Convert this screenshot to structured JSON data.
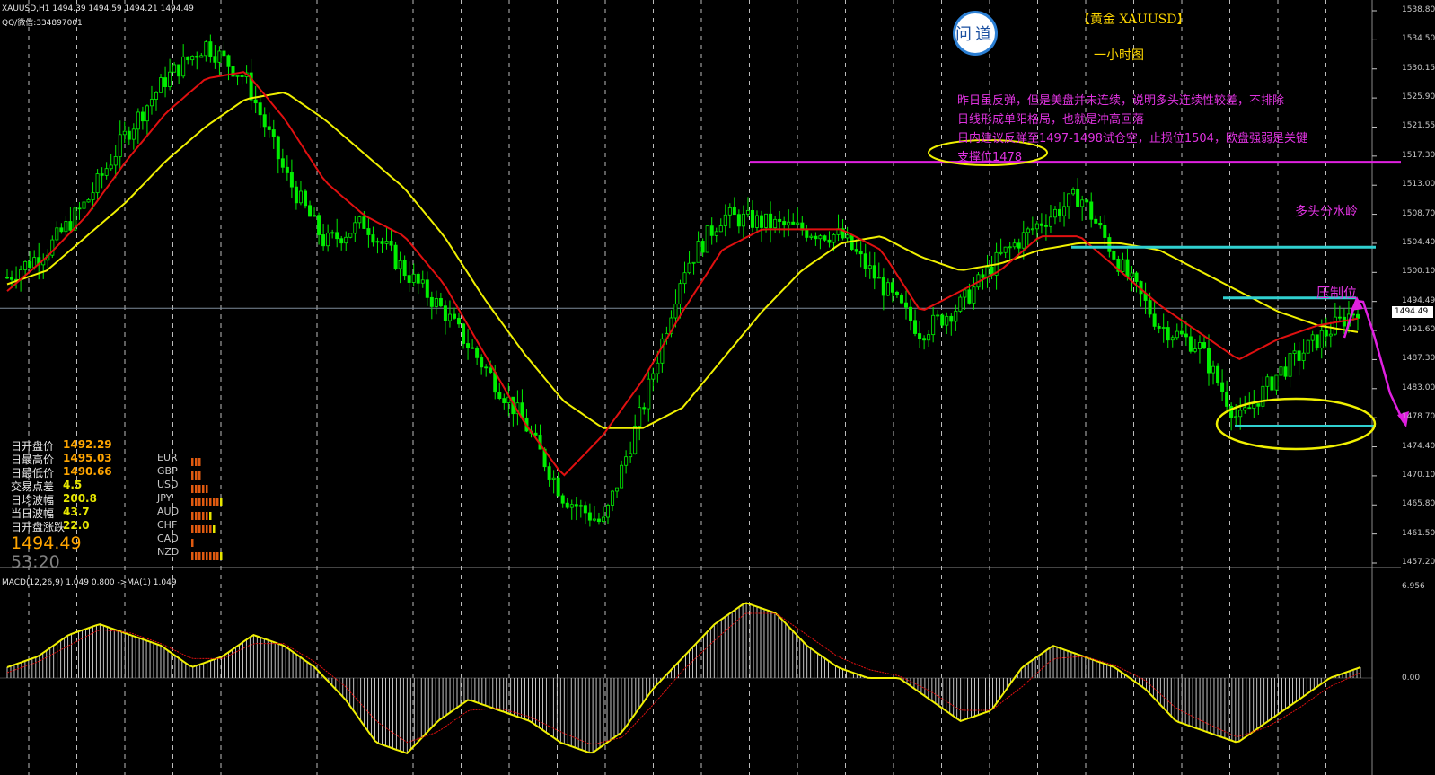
{
  "header": {
    "symbol_line": "XAUUSD,H1  1494.39 1494.59 1494.21 1494.49",
    "qq_line": "QQ/微信:334897001"
  },
  "logo": {
    "text": "问道"
  },
  "annotations": {
    "title": "【黄金 XAUUSD】",
    "subtitle": "一小时图",
    "note_lines": [
      "昨日虽反弹，但是美盘并未连续，说明多头连续性较差，不排除",
      "日线形成单阳格局，也就是冲高回落",
      "日内建议反弹至1497-1498试仓空，止损位1504，欧盘强弱是关键",
      "支撑位1478"
    ],
    "bull_divide": "多头分水岭",
    "resistance": "压制位"
  },
  "info_panel": {
    "rows": [
      {
        "label": "日开盘价",
        "value": "1492.29",
        "color": "orange"
      },
      {
        "label": "日最高价",
        "value": "1495.03",
        "color": "orange"
      },
      {
        "label": "日最低价",
        "value": "1490.66",
        "color": "orange"
      },
      {
        "label": "交易点差",
        "value": "4.5",
        "color": "yellow"
      },
      {
        "label": "日均波幅",
        "value": "200.8",
        "color": "yellow"
      },
      {
        "label": "当日波幅",
        "value": "43.7",
        "color": "yellow"
      },
      {
        "label": "日开盘涨跌",
        "value": "22.0",
        "color": "yellow"
      }
    ],
    "price": "1494.49",
    "countdown": "53:20",
    "currencies": [
      {
        "name": "EUR",
        "bars": 3
      },
      {
        "name": "GBP",
        "bars": 3
      },
      {
        "name": "USD",
        "bars": 5
      },
      {
        "name": "JPY",
        "bars": 9
      },
      {
        "name": "AUD",
        "bars": 6
      },
      {
        "name": "CHF",
        "bars": 7
      },
      {
        "name": "CAD",
        "bars": 1
      },
      {
        "name": "NZD",
        "bars": 9
      }
    ]
  },
  "price_axis": {
    "labels": [
      "1538.80",
      "1534.50",
      "1530.15",
      "1525.90",
      "1521.55",
      "1517.30",
      "1513.00",
      "1508.70",
      "1504.40",
      "1500.10",
      "1494.49",
      "1491.60",
      "1487.30",
      "1483.00",
      "1478.70",
      "1474.40",
      "1470.10",
      "1465.80",
      "1461.50",
      "1457.20"
    ],
    "current_price": "1494.49"
  },
  "macd": {
    "label": "MACD(12,26,9) 1.049 0.800  ->MA(1) 1.049",
    "axis_labels": [
      "6.956",
      "0.00"
    ]
  },
  "chart_data": {
    "type": "line",
    "instrument": "XAUUSD",
    "timeframe": "H1",
    "ylim": [
      1457.2,
      1538.8
    ],
    "series": [
      {
        "name": "fast-ma",
        "color": "#e01010",
        "points": [
          1497,
          1502,
          1508,
          1516,
          1523,
          1528,
          1529,
          1522,
          1513,
          1508,
          1505,
          1498,
          1488,
          1478,
          1470,
          1476,
          1484,
          1494,
          1503,
          1506,
          1506,
          1506,
          1503,
          1494,
          1497,
          1500,
          1505,
          1505,
          1500,
          1495,
          1491,
          1487,
          1490,
          1492,
          1493
        ]
      },
      {
        "name": "slow-ma",
        "color": "#f0f000",
        "points": [
          1498,
          1500,
          1505,
          1510,
          1516,
          1521,
          1525,
          1526,
          1522,
          1517,
          1512,
          1505,
          1496,
          1488,
          1481,
          1477,
          1477,
          1480,
          1487,
          1494,
          1500,
          1504,
          1505,
          1502,
          1500,
          1501,
          1503,
          1504,
          1504,
          1503,
          1500,
          1497,
          1494,
          1492,
          1491
        ]
      },
      {
        "name": "price",
        "color": "#00ee00",
        "points": [
          1499,
          1503,
          1510,
          1520,
          1528,
          1533,
          1528,
          1514,
          1504,
          1507,
          1500,
          1494,
          1486,
          1478,
          1467,
          1463,
          1480,
          1500,
          1508,
          1507,
          1506,
          1505,
          1498,
          1491,
          1495,
          1502,
          1507,
          1511,
          1501,
          1492,
          1489,
          1478,
          1485,
          1490,
          1494.5
        ]
      }
    ],
    "levels": [
      {
        "name": "support-1478",
        "value": 1515.8,
        "color": "#e020e0"
      },
      {
        "name": "bull-divide",
        "value": 1503.4,
        "color": "#30d0d0"
      },
      {
        "name": "resistance",
        "value": 1496.0,
        "color": "#30d0d0"
      },
      {
        "name": "support",
        "value": 1477.3,
        "color": "#30d0d0"
      }
    ],
    "macd_histogram": [
      1,
      2,
      4,
      5,
      4,
      3,
      1,
      2,
      4,
      3,
      1,
      -2,
      -6,
      -7,
      -4,
      -2,
      -3,
      -4,
      -6,
      -7,
      -5,
      -1,
      2,
      5,
      7,
      6,
      3,
      1,
      0,
      0,
      -2,
      -4,
      -3,
      1,
      3,
      2,
      1,
      -1,
      -4,
      -5,
      -6,
      -4,
      -2,
      0,
      1
    ],
    "macd_signal": [
      0.5,
      1.5,
      3,
      4.5,
      4.2,
      3.2,
      1.8,
      1.8,
      3.2,
      3.2,
      1.5,
      -0.8,
      -4,
      -6,
      -5,
      -3,
      -2.8,
      -3.6,
      -5,
      -6.2,
      -5.5,
      -2.5,
      0.8,
      3.5,
      6,
      6,
      4,
      2,
      0.8,
      0.2,
      -1.2,
      -3,
      -3,
      -0.8,
      1.8,
      2,
      1.2,
      -0.2,
      -2.8,
      -4.2,
      -5.5,
      -4.5,
      -2.8,
      -0.8,
      0.5
    ]
  }
}
